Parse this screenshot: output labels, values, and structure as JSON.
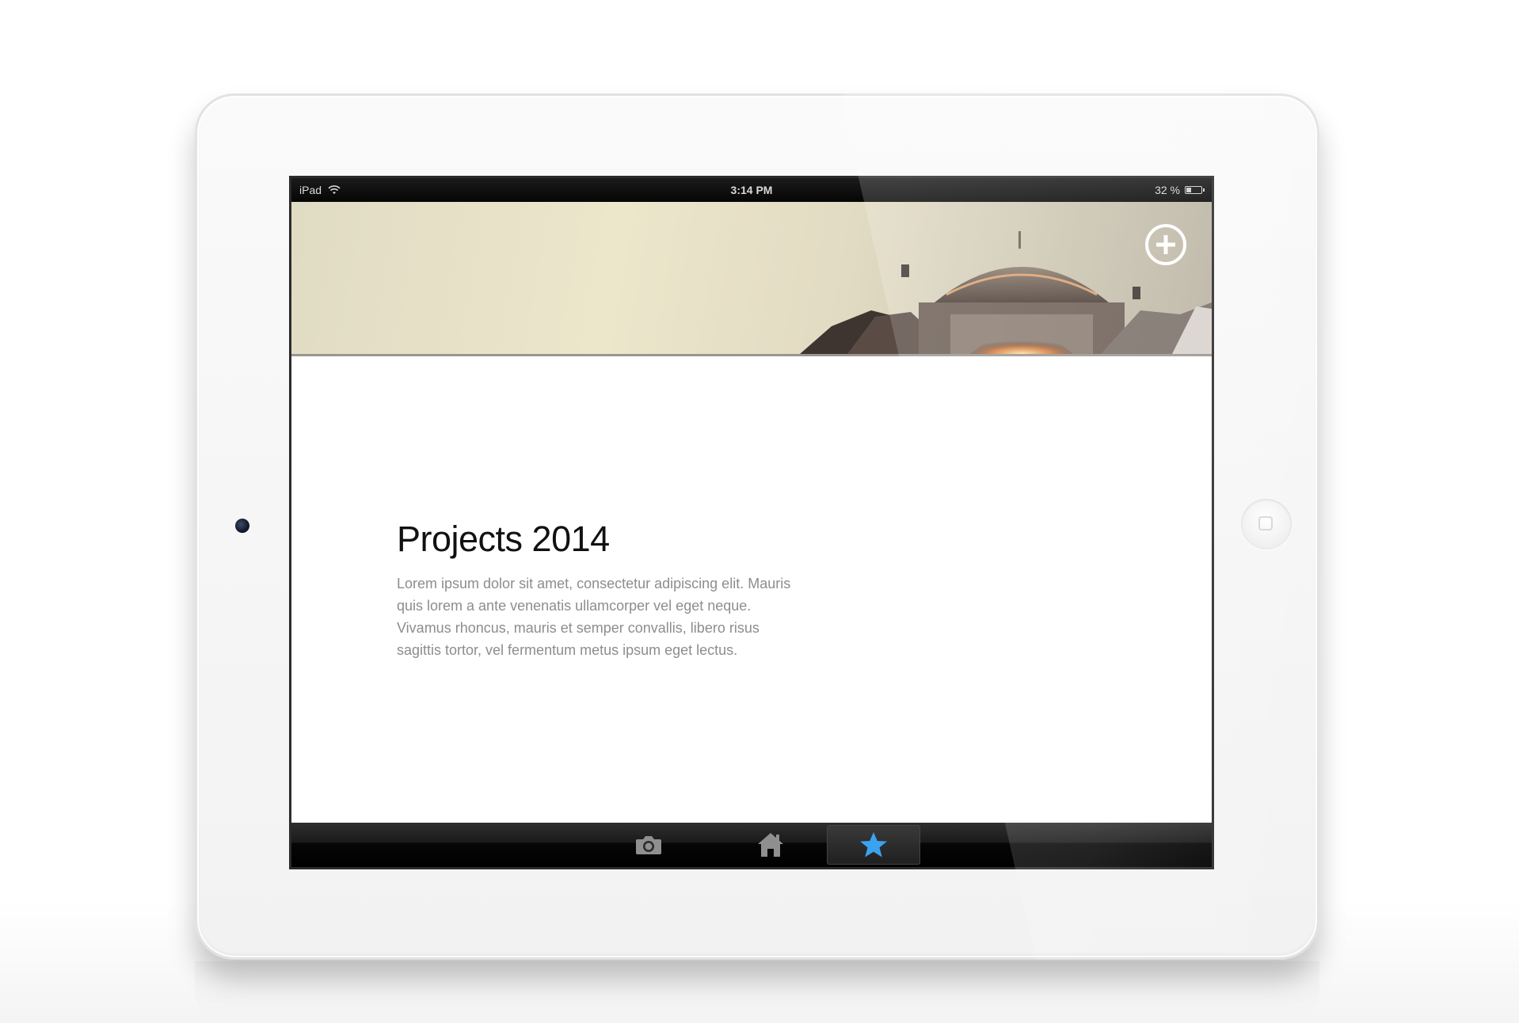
{
  "status_bar": {
    "device": "iPad",
    "time": "3:14 PM",
    "battery": "32 %",
    "battery_level": 0.32
  },
  "header": {
    "add_icon": "plus-circle-icon"
  },
  "main": {
    "title": "Projects 2014",
    "body": "Lorem ipsum dolor sit amet, consectetur adipiscing elit. Mauris quis lorem a ante venenatis ullamcorper vel eget neque. Vivamus rhoncus, mauris et semper convallis, libero risus sagittis tortor, vel fermentum metus ipsum eget lectus."
  },
  "tab_bar": {
    "tabs": [
      {
        "icon": "camera-icon",
        "active": false
      },
      {
        "icon": "home-icon",
        "active": false
      },
      {
        "icon": "star-icon",
        "active": true,
        "color": "#3aa3f0"
      }
    ]
  },
  "colors": {
    "accent": "#3aa3f0",
    "title": "#111111",
    "body_text": "#8d8d8d"
  }
}
